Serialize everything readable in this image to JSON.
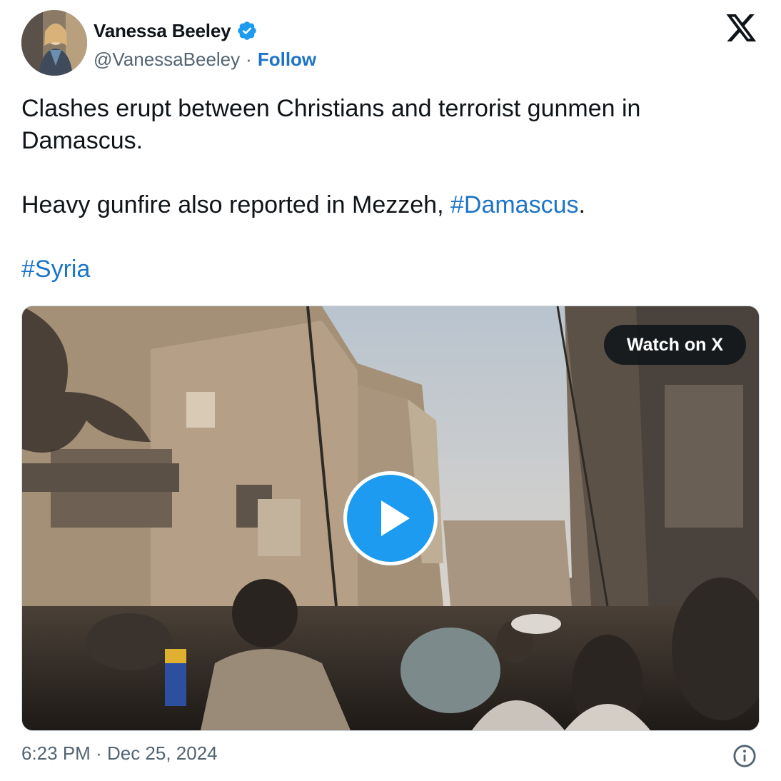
{
  "author": {
    "name": "Vanessa Beeley",
    "handle": "@VanessaBeeley",
    "separator": "·",
    "follow_label": "Follow",
    "verified": true
  },
  "icons": {
    "avatar": "profile-photo",
    "verified": "verified-badge-icon",
    "logo": "x-logo-icon",
    "play": "play-icon",
    "info": "info-icon"
  },
  "tweet": {
    "line1": "Clashes erupt between Christians and terrorist gunmen in Damascus.",
    "line2_text": "Heavy gunfire also reported in Mezzeh,  ",
    "line2_hashtag": "#Damascus",
    "line2_end": ".",
    "hashtag_syria": "#Syria"
  },
  "media": {
    "watch_label": "Watch on X"
  },
  "footer": {
    "time": "6:23 PM",
    "separator": "·",
    "date": "Dec 25, 2024"
  },
  "colors": {
    "link": "#1d74c7",
    "verified": "#1d9bf0",
    "text": "#0f1419",
    "muted": "#536471"
  }
}
